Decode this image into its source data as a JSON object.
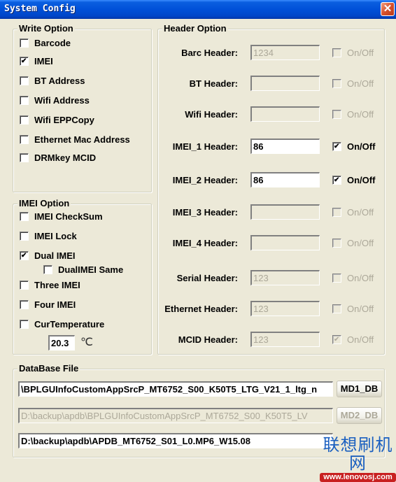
{
  "window": {
    "title": "System Config",
    "close_icon": "✕"
  },
  "write_option": {
    "title": "Write Option",
    "items": [
      {
        "label": "Barcode",
        "checked": false
      },
      {
        "label": "IMEI",
        "checked": true
      },
      {
        "label": "BT Address",
        "checked": false
      },
      {
        "label": "Wifi Address",
        "checked": false
      },
      {
        "label": "Wifi EPPCopy",
        "checked": false
      },
      {
        "label": "Ethernet Mac Address",
        "checked": false
      },
      {
        "label": "DRMkey MCID",
        "checked": false
      }
    ]
  },
  "imei_option": {
    "title": "IMEI Option",
    "items": [
      {
        "label": "IMEI CheckSum",
        "checked": false
      },
      {
        "label": "IMEI Lock",
        "checked": false
      },
      {
        "label": "Dual IMEI",
        "checked": true
      },
      {
        "label": "DualIMEI Same",
        "checked": false
      },
      {
        "label": "Three IMEI",
        "checked": false
      },
      {
        "label": "Four IMEI",
        "checked": false
      },
      {
        "label": "CurTemperature",
        "checked": false
      }
    ],
    "temperature_value": "20.3",
    "temperature_unit": "℃"
  },
  "header_option": {
    "title": "Header Option",
    "rows": [
      {
        "label": "Barc Header:",
        "value": "1234",
        "enabled": false,
        "toggle_label": "On/Off",
        "toggle_checked": false,
        "toggle_enabled": false
      },
      {
        "label": "BT Header:",
        "value": "",
        "enabled": false,
        "toggle_label": "On/Off",
        "toggle_checked": false,
        "toggle_enabled": false
      },
      {
        "label": "Wifi Header:",
        "value": "",
        "enabled": false,
        "toggle_label": "On/Off",
        "toggle_checked": false,
        "toggle_enabled": false
      },
      {
        "label": "IMEI_1 Header:",
        "value": "86",
        "enabled": true,
        "toggle_label": "On/Off",
        "toggle_checked": true,
        "toggle_enabled": true
      },
      {
        "label": "IMEI_2 Header:",
        "value": "86",
        "enabled": true,
        "toggle_label": "On/Off",
        "toggle_checked": true,
        "toggle_enabled": true
      },
      {
        "label": "IMEI_3 Header:",
        "value": "",
        "enabled": false,
        "toggle_label": "On/Off",
        "toggle_checked": false,
        "toggle_enabled": false
      },
      {
        "label": "IMEI_4 Header:",
        "value": "",
        "enabled": false,
        "toggle_label": "On/Off",
        "toggle_checked": false,
        "toggle_enabled": false
      },
      {
        "label": "Serial Header:",
        "value": "123",
        "enabled": false,
        "toggle_label": "On/Off",
        "toggle_checked": false,
        "toggle_enabled": false
      },
      {
        "label": "Ethernet Header:",
        "value": "123",
        "enabled": false,
        "toggle_label": "On/Off",
        "toggle_checked": false,
        "toggle_enabled": false
      },
      {
        "label": "MCID Header:",
        "value": "123",
        "enabled": false,
        "toggle_label": "On/Off",
        "toggle_checked": true,
        "toggle_enabled": false
      }
    ]
  },
  "database_file": {
    "title": "DataBase File",
    "md1_path": "\\BPLGUInfoCustomAppSrcP_MT6752_S00_K50T5_LTG_V21_1_ltg_n",
    "md1_button": "MD1_DB",
    "md2_path": "D:\\backup\\apdb\\BPLGUInfoCustomAppSrcP_MT6752_S00_K50T5_LV",
    "md2_button": "MD2_DB",
    "ap_path": "D:\\backup\\apdb\\APDB_MT6752_S01_L0.MP6_W15.08"
  },
  "watermark": {
    "text": "联想刷机网",
    "url": "www.lenovosj.com"
  }
}
